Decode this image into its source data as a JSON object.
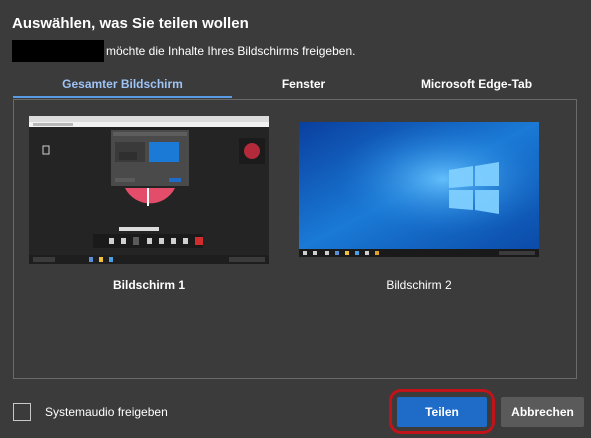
{
  "dialog": {
    "title": "Auswählen, was Sie teilen wollen",
    "subtitle": "möchte die Inhalte Ihres Bildschirms freigeben."
  },
  "tabs": [
    {
      "label": "Gesamter Bildschirm",
      "active": true
    },
    {
      "label": "Fenster",
      "active": false
    },
    {
      "label": "Microsoft Edge-Tab",
      "active": false
    }
  ],
  "screens": [
    {
      "label": "Bildschirm 1",
      "selected": true
    },
    {
      "label": "Bildschirm 2",
      "selected": false
    }
  ],
  "footer": {
    "system_audio_label": "Systemaudio freigeben",
    "system_audio_checked": false,
    "share_button": "Teilen",
    "cancel_button": "Abbrechen"
  },
  "colors": {
    "background": "#3b3b3b",
    "accent": "#1f6bc8",
    "active_tab": "#9ec3f5",
    "highlight": "#c0131a"
  }
}
